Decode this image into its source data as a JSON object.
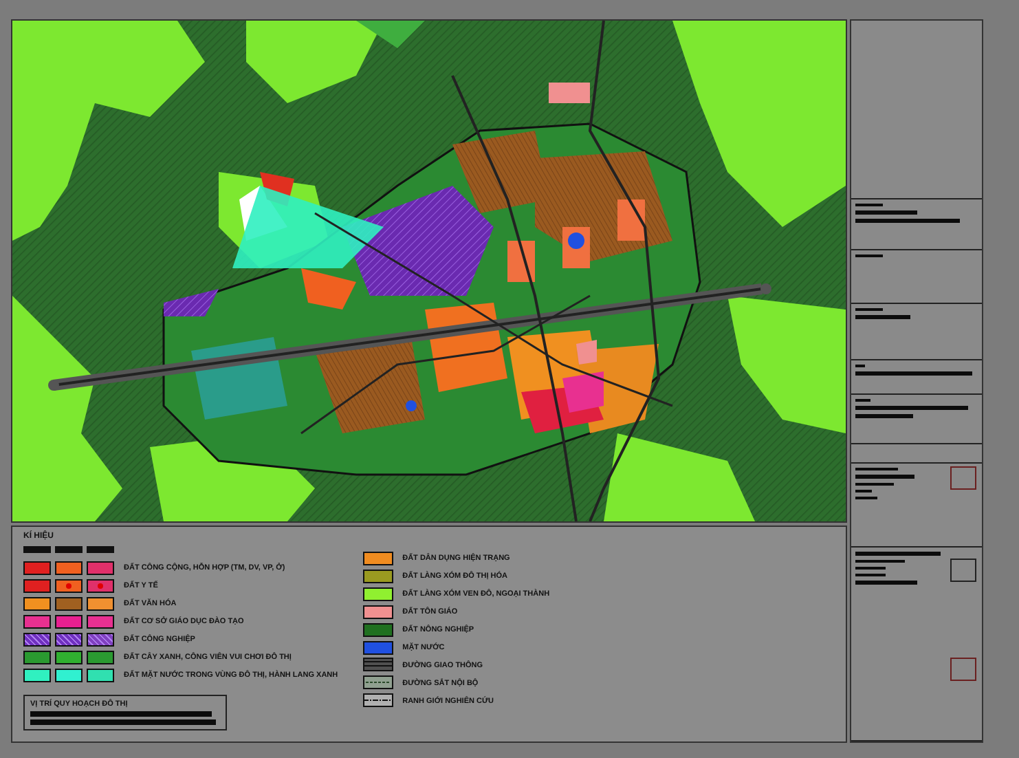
{
  "legend": {
    "title": "KÍ HIỆU",
    "land_use": [
      {
        "label": "ĐẤT CÔNG CỘNG, HỖN HỢP (TM, DV, VP, Ở)",
        "swatches": [
          {
            "color": "#e02020"
          },
          {
            "color": "#f06020"
          },
          {
            "color": "#e0306a"
          }
        ],
        "marked": false,
        "hatched": false
      },
      {
        "label": "ĐẤT Y TẾ",
        "swatches": [
          {
            "color": "#e02020"
          },
          {
            "color": "#f06020"
          },
          {
            "color": "#e0306a"
          }
        ],
        "marked": true,
        "hatched": false
      },
      {
        "label": "ĐẤT VĂN HÓA",
        "swatches": [
          {
            "color": "#f09020"
          },
          {
            "color": "#a06020"
          },
          {
            "color": "#f09030"
          }
        ],
        "marked": false,
        "hatched": false
      },
      {
        "label": "ĐẤT CƠ SỞ GIÁO DỤC ĐÀO TẠO",
        "swatches": [
          {
            "color": "#e83090"
          },
          {
            "color": "#e82090"
          },
          {
            "color": "#e83091"
          }
        ],
        "marked": false,
        "hatched": false
      },
      {
        "label": "ĐẤT CÔNG NGHIỆP",
        "swatches": [
          {
            "color": "#7030c0"
          },
          {
            "color": "#7031c0"
          },
          {
            "color": "#8040c0"
          }
        ],
        "marked": false,
        "hatched": true
      },
      {
        "label": "ĐẤT CÂY XANH, CÔNG VIÊN VUI CHƠI ĐÔ THỊ",
        "swatches": [
          {
            "color": "#2a9a30"
          },
          {
            "color": "#30b030"
          },
          {
            "color": "#2a9a31"
          }
        ],
        "marked": false,
        "hatched": false
      },
      {
        "label": "ĐẤT MẶT NƯỚC TRONG VÙNG ĐÔ THỊ, HÀNH LANG XANH",
        "swatches": [
          {
            "color": "#30f0c0"
          },
          {
            "color": "#30f0d0"
          },
          {
            "color": "#30e0b0"
          }
        ],
        "marked": false,
        "hatched": false
      }
    ],
    "other": [
      {
        "kind": "fill",
        "label": "ĐẤT DÂN DỤNG HIỆN TRẠNG",
        "color": "#f08c20"
      },
      {
        "kind": "fill",
        "label": "ĐẤT LÀNG XÓM ĐÔ THỊ HÓA",
        "color": "#9a9a20"
      },
      {
        "kind": "fill",
        "label": "ĐẤT LÀNG XÓM VEN ĐÔ, NGOẠI THÀNH",
        "color": "#90f030"
      },
      {
        "kind": "fill",
        "label": "ĐẤT TÔN GIÁO",
        "color": "#f09090"
      },
      {
        "kind": "fill",
        "label": "ĐẤT NÔNG NGHIỆP",
        "color": "#207020"
      },
      {
        "kind": "fill",
        "label": "MẶT NƯỚC",
        "color": "#2050e0"
      },
      {
        "kind": "road",
        "label": "ĐƯỜNG GIAO THÔNG",
        "color": "#505050"
      },
      {
        "kind": "rail",
        "label": "ĐƯỜNG SẮT NỘI BỘ",
        "color": "#90a090"
      },
      {
        "kind": "boundary",
        "label": "RANH GIỚI NGHIÊN CỨU",
        "color": "#b0b0b0"
      }
    ],
    "locator": {
      "title": "VỊ TRÍ QUY HOẠCH ĐÔ THỊ"
    }
  }
}
